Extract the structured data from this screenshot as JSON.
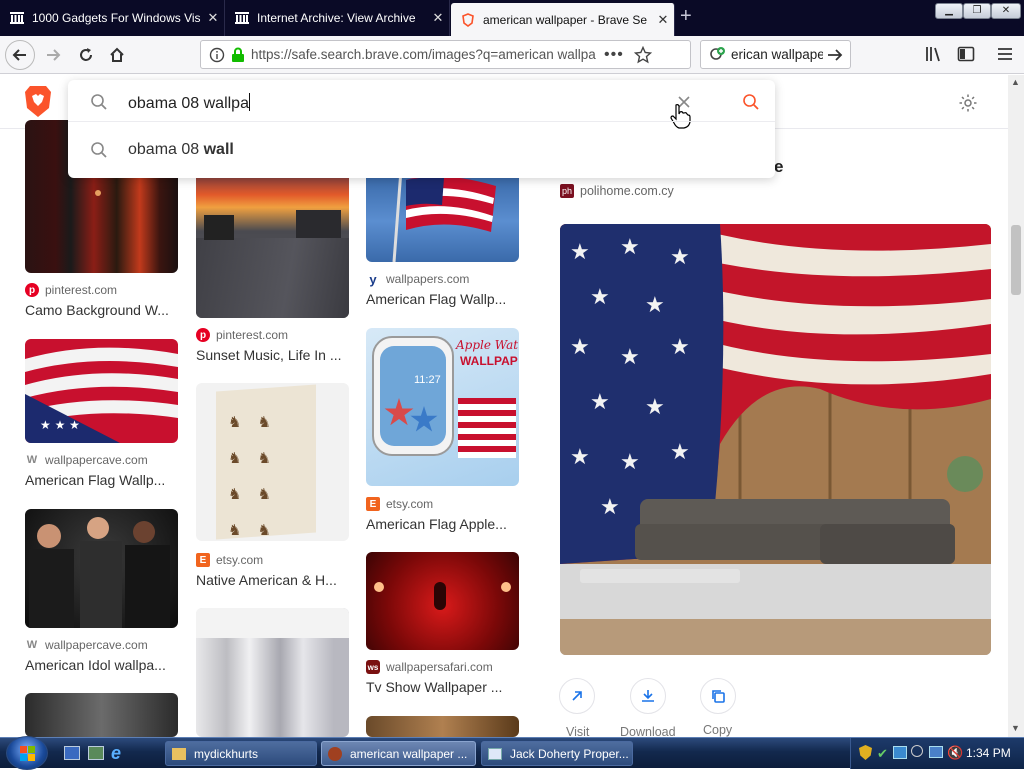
{
  "tabs": [
    {
      "label": "1000 Gadgets For Windows Vis",
      "active": false
    },
    {
      "label": "Internet Archive: View Archive",
      "active": false
    },
    {
      "label": "american wallpaper - Brave Se",
      "active": true
    }
  ],
  "navbar": {
    "url": "https://safe.search.brave.com/images?q=american wallpa",
    "search_value": "erican wallpape"
  },
  "search": {
    "query": "obama 08 wallpa",
    "suggestion_prefix": "obama 08 ",
    "suggestion_bold": "wall"
  },
  "results": {
    "col1": [
      {
        "source": "pinterest.com",
        "caption": "Camo Background W..."
      },
      {
        "source": "wallpapercave.com",
        "caption": "American Flag Wallp..."
      },
      {
        "source": "wallpapercave.com",
        "caption": "American Idol wallpa..."
      }
    ],
    "col2": [
      {
        "source": "pinterest.com",
        "caption": "Sunset Music, Life In ..."
      },
      {
        "source": "etsy.com",
        "caption": "Native American & H..."
      }
    ],
    "col3": [
      {
        "source": "wallpapers.com",
        "caption": "American Flag Wallp..."
      },
      {
        "source": "etsy.com",
        "caption": "American Flag Apple..."
      },
      {
        "source": "wallpapersafari.com",
        "caption": "Tv Show Wallpaper ..."
      }
    ]
  },
  "watch_image": {
    "time": "11:27",
    "brand_line1": "Apple Wat",
    "brand_line2": "WALLPAP"
  },
  "preview": {
    "title_fragment": "e",
    "source": "polihome.com.cy",
    "source_fav": "ph",
    "actions": [
      "Visit",
      "Download",
      "Copy"
    ]
  },
  "taskbar": {
    "items": [
      {
        "label": "mydickhurts",
        "active": false
      },
      {
        "label": "american wallpaper ...",
        "active": true
      },
      {
        "label": "Jack Doherty Proper...",
        "active": false
      }
    ],
    "clock": "1:34 PM"
  },
  "colors": {
    "brave": "#fb542b",
    "pinterest": "#e60023",
    "etsy": "#f1641e",
    "tab_bg": "#0a0a26"
  }
}
